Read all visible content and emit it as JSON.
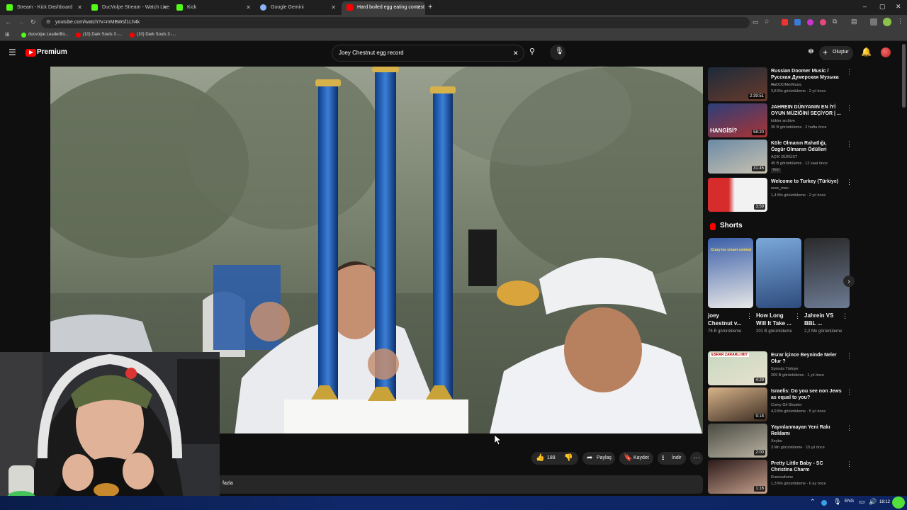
{
  "browser": {
    "tabs": [
      {
        "label": "Stream - Kick Dashboard",
        "fav_color": "#53fc18"
      },
      {
        "label": "DucVolpe Stream - Watch Live",
        "fav_color": "#53fc18"
      },
      {
        "label": "Kick",
        "fav_color": "#53fc18"
      },
      {
        "label": "Google Gemini",
        "fav_color": "#8ab4f8"
      },
      {
        "label": "Hard boiled egg eating contest",
        "fav_color": "#ff0000"
      }
    ],
    "url": "youtube.com/watch?v=mMBWsf1Lh4k",
    "bookmarks": [
      {
        "label": "ducvolpe LeaderBo...",
        "color": "#53fc18"
      },
      {
        "label": "(10) Dark Souls 3 -...",
        "color": "#ff0000"
      },
      {
        "label": "(10) Dark Souls 3 -...",
        "color": "#ff0000"
      }
    ]
  },
  "youtube": {
    "logo_text": "Premium",
    "search_value": "Joey Chestnut egg record",
    "create_label": "Oluştur",
    "accent": "#ff0000"
  },
  "actions": {
    "likes": "188",
    "share": "Paylaş",
    "save": "Kaydet",
    "download": "İndir",
    "more_text": "fazla"
  },
  "recommendations": [
    {
      "title": "Russian Doomer Music / Русская Думерская Музыка ...",
      "channel": "RuDOOMerMusic",
      "stats": "3,8 Mn görüntüleme · 2 yıl önce",
      "duration": "2:39:51",
      "thumb": [
        "#1c2a3a",
        "#6a3b2b"
      ]
    },
    {
      "title": "JAHREIN DÜNYANIN EN İYİ OYUN MÜZİĞİNİ SEÇİYOR | ...",
      "channel": "kökler archive",
      "stats": "30 B görüntüleme · 2 hafta önce",
      "duration": "58:20",
      "thumb": [
        "#2c3f7a",
        "#a33"
      ],
      "overlay": "HANGİSİ?"
    },
    {
      "title": "Köle Olmanın Rahatlığı, Özgür Olmanın Ödülleri",
      "channel": "AÇIK DÜRÜST",
      "stats": "45 B görüntüleme · 12 saat önce",
      "badge": "Yeni",
      "duration": "31:45",
      "thumb": [
        "#6b8aa6",
        "#c9c2b0"
      ]
    },
    {
      "title": "Welcome to Turkey (Türkiye)",
      "channel": "wow_mao",
      "stats": "1,4 Mn görüntüleme · 2 yıl önce",
      "duration": "3:59",
      "thumb": [
        "#d62c2c",
        "#f2f2f2"
      ]
    }
  ],
  "shorts": {
    "heading": "Shorts",
    "items": [
      {
        "title": "joey Chestnut v...",
        "stats": "76 B görüntüleme",
        "thumb": [
          "#3b5fa8",
          "#e7e7e7"
        ],
        "caption": "Crazy ice cream contest"
      },
      {
        "title": "How Long Will It Take ...",
        "stats": "201 B görüntüleme",
        "thumb": [
          "#7aa7d9",
          "#2e4c7d"
        ]
      },
      {
        "title": "Jahrein VS BBL ...",
        "stats": "2,2 Mn görüntüleme",
        "thumb": [
          "#2a2a2a",
          "#6c7a93"
        ]
      }
    ]
  },
  "recommendations2": [
    {
      "title": "Esrar İçince Beyninde Neler Olur ?",
      "channel": "Sprouts Türkiye",
      "stats": "209 B görüntüleme · 1 yıl önce",
      "duration": "4:29",
      "thumb": [
        "#c5d7c0",
        "#e8e2cf"
      ],
      "overlay": "ESRAR ZARARLI MI?"
    },
    {
      "title": "Israelis: Do you see non Jews as equal to you?",
      "channel": "Corey Gil-Shuster",
      "stats": "4,9 Mn görüntüleme · 5 yıl önce",
      "duration": "9:18",
      "thumb": [
        "#d8b48a",
        "#3b2c22"
      ]
    },
    {
      "title": "Yayınlanmayan Yeni Rakı Reklamı",
      "channel": "Xeybo",
      "stats": "3 Mn görüntüleme · 15 yıl önce",
      "duration": "2:00",
      "thumb": [
        "#4a4a42",
        "#b9b3a2"
      ]
    },
    {
      "title": "Pretty Little Baby - SC Christina Charm",
      "channel": "Ruensafume",
      "stats": "1,3 Mn görüntüleme · 6 ay önce",
      "duration": "1:16",
      "thumb": [
        "#2b1a1a",
        "#c7a18c"
      ]
    }
  ],
  "taskbar": {
    "lang": "ENG",
    "time": "18:12"
  }
}
